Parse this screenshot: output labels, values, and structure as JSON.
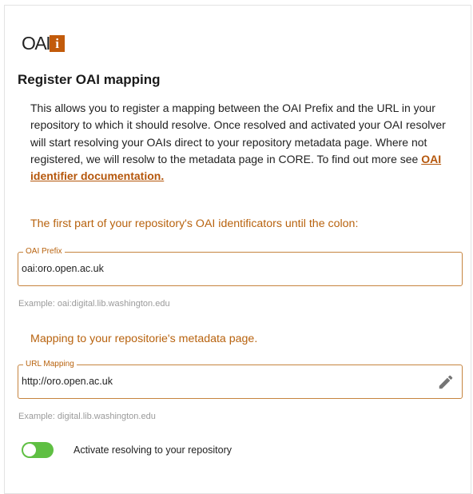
{
  "logo": {
    "text": "OAI",
    "box_letter": "i",
    "accent_color": "#c25b0b"
  },
  "page_title": "Register OAI mapping",
  "description": {
    "text": "This allows you to register a mapping between the OAI Prefix and the URL in your repository to which it should resolve. Once resolved and activated your OAI resolver will start resolving your OAIs direct to your repository metadata page. Where not registered, we will resolw to the metadata page in CORE. To find out more see ",
    "link_text": "OAI identifier documentation."
  },
  "prefix_section": {
    "label": "The first part of your repository's OAI identificators until the colon:",
    "field_legend": "OAI Prefix",
    "field_value": "oai:oro.open.ac.uk",
    "example": "Example: oai:digital.lib.washington.edu"
  },
  "mapping_section": {
    "label": "Mapping to your repositorie's metadata page.",
    "field_legend": "URL Mapping",
    "field_value": "http://oro.open.ac.uk",
    "edit_icon": "pencil-icon",
    "example": "Example: digital.lib.washington.edu"
  },
  "activate_toggle": {
    "label": "Activate resolving to your repository",
    "state": "on",
    "color": "#5fbf43"
  },
  "colors": {
    "section_label": "#b8630f",
    "field_border": "#c6843f",
    "example_text": "#9a9a9a"
  }
}
